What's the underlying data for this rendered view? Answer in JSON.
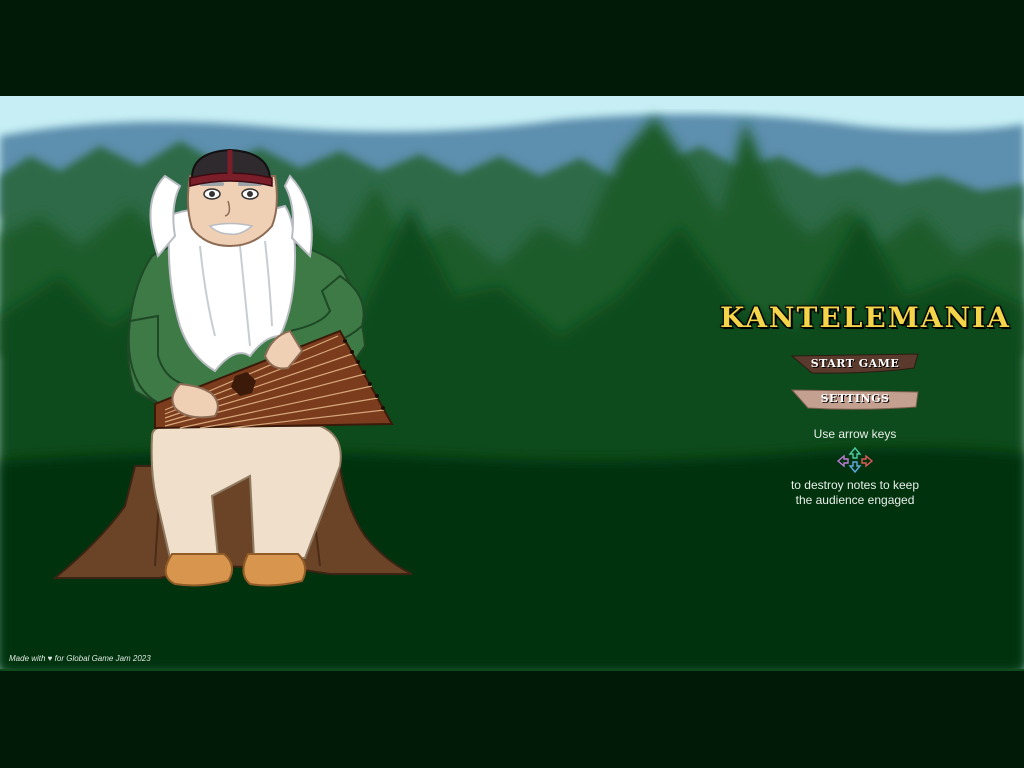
{
  "game": {
    "title": "KANTELEMANIA"
  },
  "menu": {
    "start_label": "START GAME",
    "settings_label": "SETTINGS"
  },
  "instructions": {
    "line1": "Use arrow keys",
    "line2": "to destroy notes to keep",
    "line3": "the audience engaged"
  },
  "arrow_icons": [
    {
      "name": "arrow-up-icon",
      "color": "#4ec9a0"
    },
    {
      "name": "arrow-left-icon",
      "color": "#c07cd8"
    },
    {
      "name": "arrow-down-icon",
      "color": "#5fa8e0"
    },
    {
      "name": "arrow-right-icon",
      "color": "#e05a5a"
    }
  ],
  "footer": {
    "credits": "Made with ♥ for Global Game Jam 2023"
  },
  "colors": {
    "sky": "#c6eef4",
    "far_hills": "#5d8fae",
    "forest_mid": "#2f6b46",
    "forest_dark": "#104c1d",
    "ground": "#06300f",
    "title_yellow": "#f4d54a",
    "button_dark": "#5a3a2c",
    "button_light": "#c4a090"
  }
}
